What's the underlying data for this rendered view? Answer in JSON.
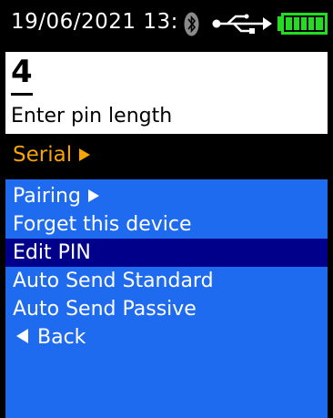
{
  "status_bar": {
    "datetime": "19/06/2021 13:",
    "icons": [
      "bluetooth-icon",
      "usb-icon",
      "battery-icon"
    ],
    "battery_level": 1.0
  },
  "input": {
    "value": "4",
    "prompt": "Enter pin length"
  },
  "section": {
    "label": "Serial",
    "icon": "triangle-right-icon"
  },
  "menu": {
    "items": [
      {
        "label": "Pairing",
        "has_submenu": true,
        "selected": false
      },
      {
        "label": "Forget this device",
        "has_submenu": false,
        "selected": false
      },
      {
        "label": "Edit PIN",
        "has_submenu": false,
        "selected": true
      },
      {
        "label": "Auto Send Standard",
        "has_submenu": false,
        "selected": false
      },
      {
        "label": "Auto Send Passive",
        "has_submenu": false,
        "selected": false
      },
      {
        "label": "Back",
        "has_submenu": false,
        "selected": false,
        "icon": "triangle-left-icon"
      }
    ]
  },
  "colors": {
    "background": "#000000",
    "input_background": "#ffffff",
    "section_label": "#f5a400",
    "menu_background": "#1f6bf0",
    "menu_selected": "#00008a",
    "menu_text": "#ffffff",
    "battery": "#22dd22"
  }
}
